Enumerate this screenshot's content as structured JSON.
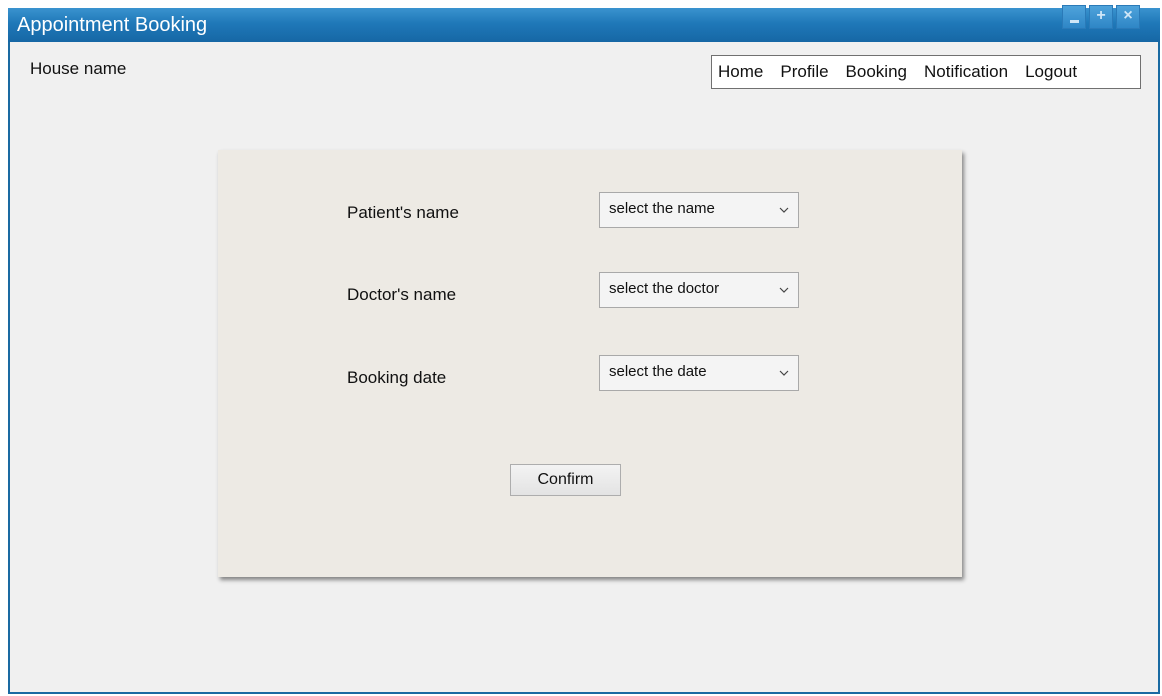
{
  "window": {
    "title": "Appointment Booking"
  },
  "header": {
    "house_name": "House name"
  },
  "nav": {
    "items": [
      "Home",
      "Profile",
      "Booking",
      "Notification",
      "Logout"
    ]
  },
  "form": {
    "patient_label": "Patient's name",
    "patient_select": "select the name",
    "doctor_label": "Doctor's name",
    "doctor_select": "select the doctor",
    "date_label": "Booking date",
    "date_select": "select the date",
    "confirm_label": "Confirm"
  },
  "colors": {
    "titlebar": "#1f78b8",
    "panel": "#edeae4",
    "background": "#f0f0f0"
  }
}
